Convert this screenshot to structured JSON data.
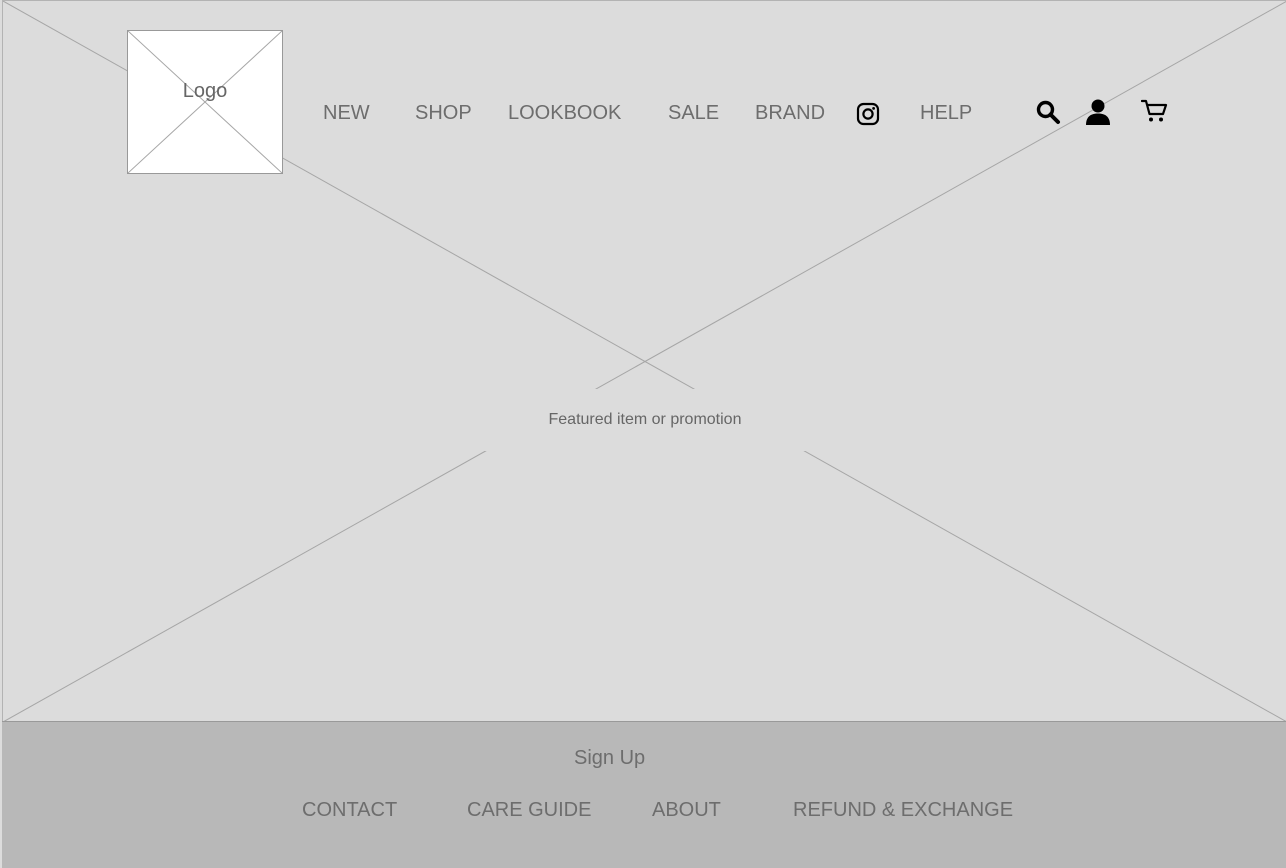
{
  "header": {
    "logo_label": "Logo",
    "nav": {
      "new": "NEW",
      "shop": "SHOP",
      "lookbook": "LOOKBOOK",
      "sale": "SALE",
      "brand": "BRAND",
      "help": "HELP"
    },
    "icons": [
      "instagram-icon",
      "search-icon",
      "user-icon",
      "cart-icon"
    ]
  },
  "hero": {
    "caption": "Featured item or promotion"
  },
  "footer": {
    "signup": "Sign Up",
    "links": {
      "contact": "CONTACT",
      "care_guide": "CARE GUIDE",
      "about": "ABOUT",
      "refund_exchange": "REFUND & EXCHANGE"
    }
  },
  "colors": {
    "hero_bg": "#dcdcdc",
    "footer_bg": "#b8b8b8",
    "text": "#6d6d6d",
    "icon": "#000000"
  }
}
